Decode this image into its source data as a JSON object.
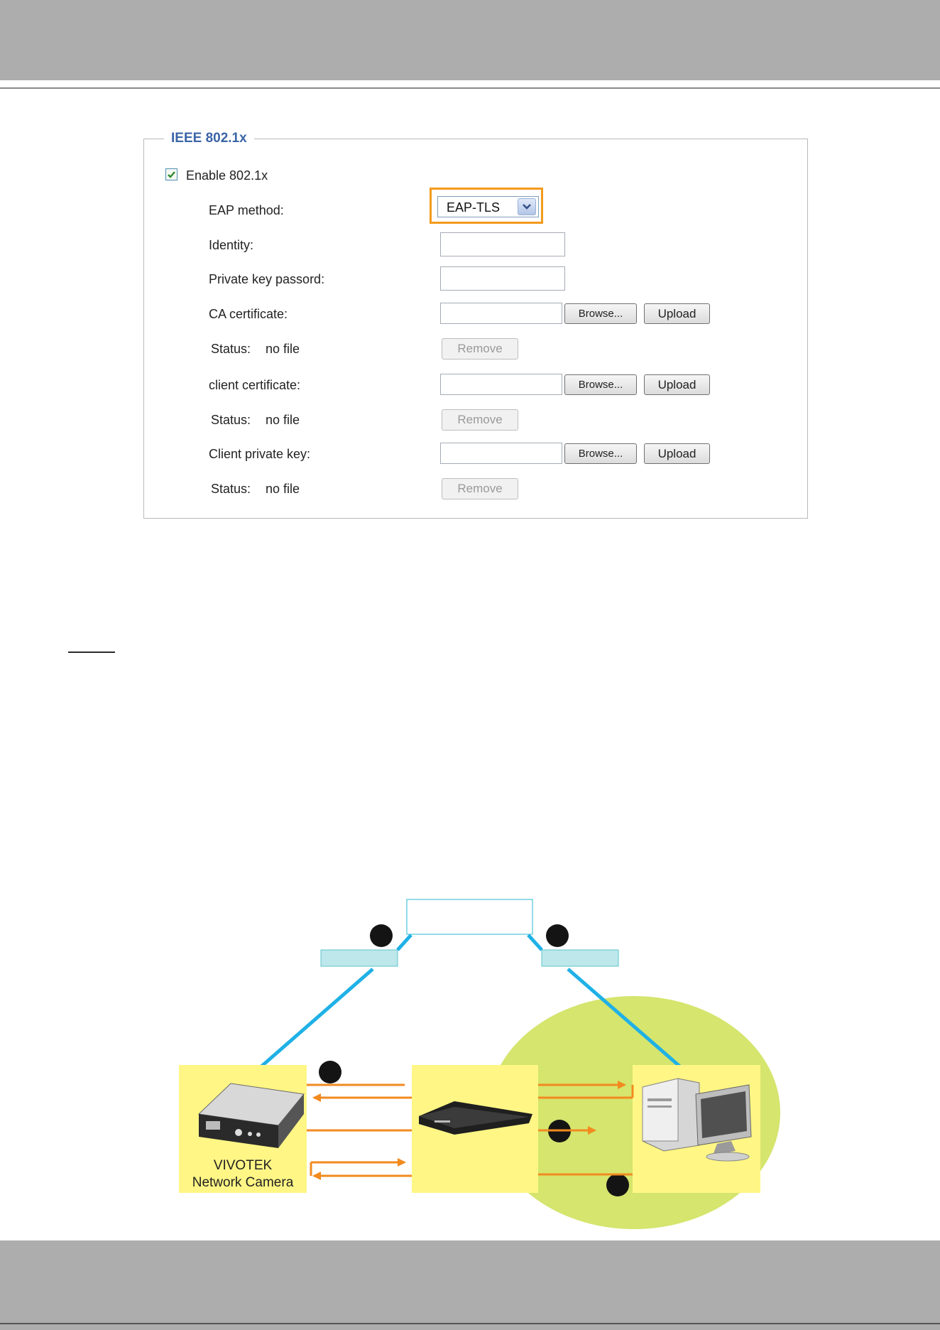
{
  "settings": {
    "section_title": "IEEE 802.1x",
    "enable_label": "Enable 802.1x",
    "enable_checked": true,
    "eap_label": "EAP method:",
    "eap_value": "EAP-TLS",
    "identity_label": "Identity:",
    "identity_value": "",
    "private_key_label": "Private key passord:",
    "private_key_value": "",
    "ca_label": "CA certificate:",
    "ca_status_label": "Status:",
    "ca_status_value": "no file",
    "client_cert_label": "client certificate:",
    "client_cert_status_label": "Status:",
    "client_cert_status_value": "no file",
    "client_key_label": "Client private key:",
    "client_key_status_label": "Status:",
    "client_key_status_value": "no file",
    "browse_label": "Browse...",
    "upload_label": "Upload",
    "remove_label": "Remove"
  },
  "diagram": {
    "camera_caption_line1": "VIVOTEK",
    "camera_caption_line2": "Network Camera"
  },
  "colors": {
    "header_gray": "#adadad",
    "highlight_orange": "#f39a1c",
    "arrow_blue": "#1fb1e6",
    "arrow_orange": "#f28a1f",
    "zone_green": "#d5e56d",
    "box_yellow": "#fff685"
  }
}
